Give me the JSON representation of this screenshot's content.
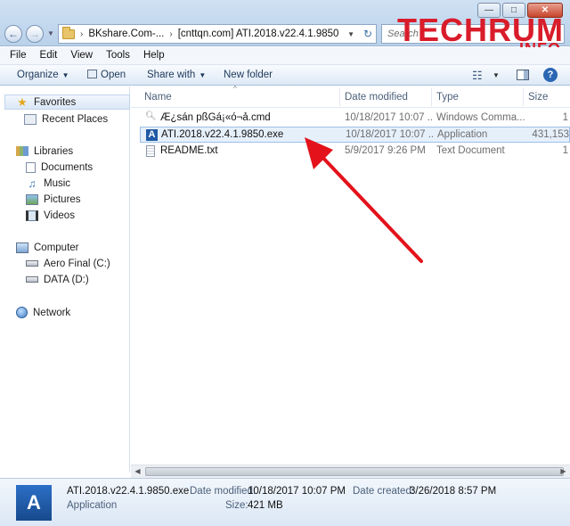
{
  "window": {
    "min": "—",
    "max": "□",
    "close": "✕"
  },
  "address": {
    "crumb1": "BKshare.Com-...",
    "crumb2": "[cnttqn.com] ATI.2018.v22.4.1.9850",
    "search_placeholder": "Search"
  },
  "watermark": {
    "main": "TECHRUM",
    "sub": ".INFO"
  },
  "menu": [
    "File",
    "Edit",
    "View",
    "Tools",
    "Help"
  ],
  "toolbar": {
    "organize": "Organize",
    "open": "Open",
    "share_with": "Share with",
    "new_folder": "New folder",
    "help": "?"
  },
  "nav": {
    "favorites": "Favorites",
    "recent_places": "Recent Places",
    "libraries": "Libraries",
    "documents": "Documents",
    "music": "Music",
    "pictures": "Pictures",
    "videos": "Videos",
    "computer": "Computer",
    "drive_c": "Aero Final (C:)",
    "drive_d": "DATA (D:)",
    "network": "Network"
  },
  "columns": {
    "name": "Name",
    "date": "Date modified",
    "type": "Type",
    "size": "Size"
  },
  "files": [
    {
      "name": "Æ¿sán pßGá¡«ó¬ả.cmd",
      "date": "10/18/2017 10:07 ...",
      "type": "Windows Comma...",
      "size": "1",
      "icon": "cmd-icon"
    },
    {
      "name": "ATI.2018.v22.4.1.9850.exe",
      "date": "10/18/2017 10:07 ...",
      "type": "Application",
      "size": "431,153",
      "icon": "app-icon",
      "icon_glyph": "A"
    },
    {
      "name": "README.txt",
      "date": "5/9/2017 9:26 PM",
      "type": "Text Document",
      "size": "1",
      "icon": "txt-icon"
    }
  ],
  "details": {
    "icon_glyph": "A",
    "filename": "ATI.2018.v22.4.1.9850.exe",
    "filetype": "Application",
    "date_modified_label": "Date modified:",
    "date_modified": "10/18/2017 10:07 PM",
    "date_created_label": "Date created:",
    "date_created": "3/26/2018 8:57 PM",
    "size_label": "Size:",
    "size": "421 MB"
  },
  "colors": {
    "accent": "#1f5aa5",
    "arrow": "#e3121b",
    "watermark": "#d91c2a"
  }
}
